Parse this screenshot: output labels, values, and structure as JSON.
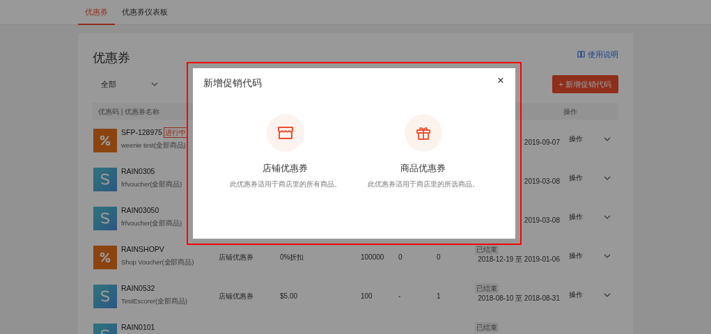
{
  "top_tabs": [
    {
      "label": "优惠券",
      "selected": true
    },
    {
      "label": "优惠券仪表板",
      "selected": false
    }
  ],
  "page": {
    "title": "优惠券",
    "help_link": "使用说明",
    "filter": {
      "value": "全部"
    },
    "add_button": "+ 新增促销代码"
  },
  "table": {
    "columns": [
      "优惠码 | 优惠券名称",
      "操作"
    ],
    "rows": [
      {
        "kind": "percent",
        "code": "SFP-128975",
        "badge": "进行中",
        "name": "weenie test(全部商品)",
        "type": "",
        "value": "",
        "quantity": "",
        "used": "",
        "col_6": "",
        "status": "",
        "date": "2019-09-07",
        "action": "操作"
      },
      {
        "kind": "dollar",
        "code": "RAIN0305",
        "badge": "",
        "name": "frfvoucher(全部商品)",
        "type": "",
        "value": "",
        "quantity": "",
        "used": "",
        "col_6": "",
        "status": "",
        "date": "2019-03-08",
        "action": "操作"
      },
      {
        "kind": "dollar",
        "code": "RAIN03050",
        "badge": "",
        "name": "frfvoucher(全部商品)",
        "type": "",
        "value": "",
        "quantity": "",
        "used": "",
        "col_6": "",
        "status": "",
        "date": "2019-03-08",
        "action": "操作"
      },
      {
        "kind": "percent",
        "code": "RAINSHOPV",
        "badge": "",
        "name": "Shop Voucher(全部商品)",
        "type": "店铺优惠券",
        "value": "0%折扣",
        "quantity": "100000",
        "used": "0",
        "col_6": "0",
        "status": "已结束",
        "date": "2018-12-19 至 2019-01-06",
        "action": "操作"
      },
      {
        "kind": "dollar",
        "code": "RAIN0532",
        "badge": "",
        "name": "TestEscorer(全部商品)",
        "type": "店铺优惠券",
        "value": "$5.00",
        "quantity": "100",
        "used": "-",
        "col_6": "1",
        "status": "已结束",
        "date": "2018-08-10 至 2018-08-31",
        "action": "操作"
      },
      {
        "kind": "dollar",
        "code": "RAIN0101",
        "badge": "",
        "name": "",
        "type": "",
        "value": "",
        "quantity": "",
        "used": "",
        "col_6": "",
        "status": "已结束",
        "date": "",
        "action": ""
      }
    ]
  },
  "modal": {
    "title": "新增促销代码",
    "close": "×",
    "options": [
      {
        "kind": "shop",
        "title": "店铺优惠券",
        "description": "此优惠券适用于商店里的所有商品。"
      },
      {
        "kind": "product",
        "title": "商品优惠券",
        "description": "此优惠券适用于商店里的所选商品。"
      }
    ]
  }
}
